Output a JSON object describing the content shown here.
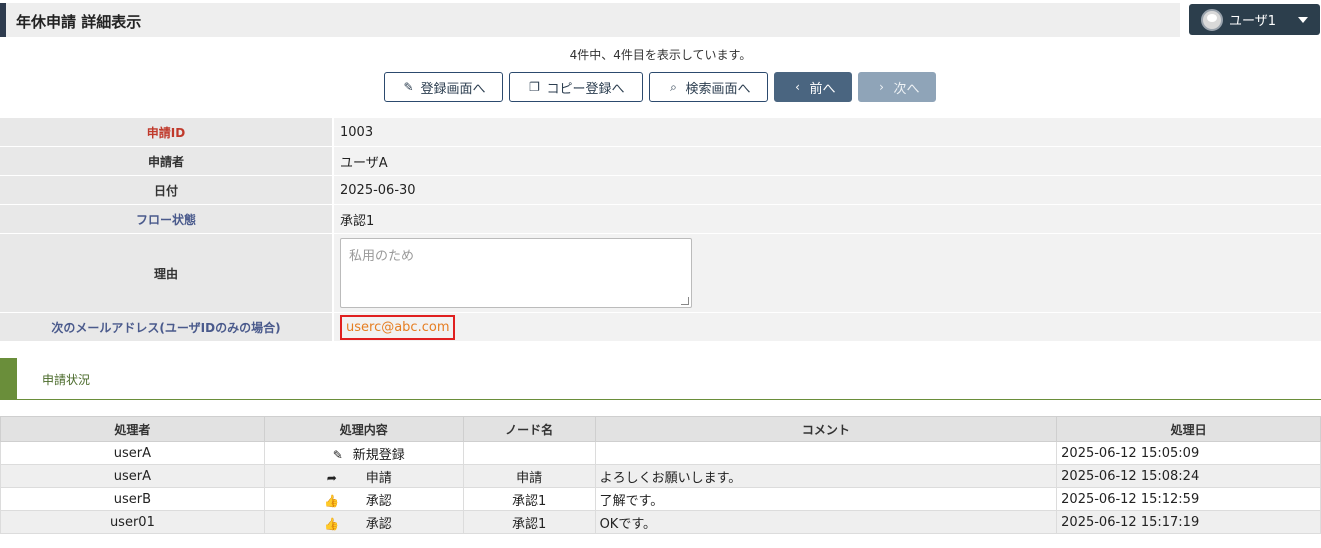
{
  "header": {
    "title": "年休申請 詳細表示",
    "user_name": "ユーザ1"
  },
  "pager": {
    "count_text": "4件中、4件目を表示しています。"
  },
  "buttons": {
    "register": "登録画面へ",
    "copy": "コピー登録へ",
    "search": "検索画面へ",
    "prev": "前へ",
    "next": "次へ"
  },
  "detail": {
    "id_label": "申請ID",
    "id_value": "1003",
    "applicant_label": "申請者",
    "applicant_value": "ユーザA",
    "date_label": "日付",
    "date_value": "2025-06-30",
    "flow_label": "フロー状態",
    "flow_value": "承認1",
    "reason_label": "理由",
    "reason_placeholder": "私用のため",
    "mail_label": "次のメールアドレス(ユーザIDのみの場合)",
    "mail_value": "userc@abc.com"
  },
  "history": {
    "section_title": "申請状況",
    "columns": [
      "処理者",
      "処理内容",
      "ノード名",
      "コメント",
      "処理日"
    ],
    "rows": [
      {
        "user": "userA",
        "action": "新規登録",
        "action_icon": "pencil-icon",
        "node": "",
        "comment": "",
        "date": "2025-06-12 15:05:09"
      },
      {
        "user": "userA",
        "action": "申請",
        "action_icon": "share-icon",
        "node": "申請",
        "comment": "よろしくお願いします。",
        "date": "2025-06-12 15:08:24"
      },
      {
        "user": "userB",
        "action": "承認",
        "action_icon": "thumbs-up-icon",
        "node": "承認1",
        "comment": "了解です。",
        "date": "2025-06-12 15:12:59"
      },
      {
        "user": "user01",
        "action": "承認",
        "action_icon": "thumbs-up-icon",
        "node": "承認1",
        "comment": "OKです。",
        "date": "2025-06-12 15:17:19"
      }
    ]
  }
}
